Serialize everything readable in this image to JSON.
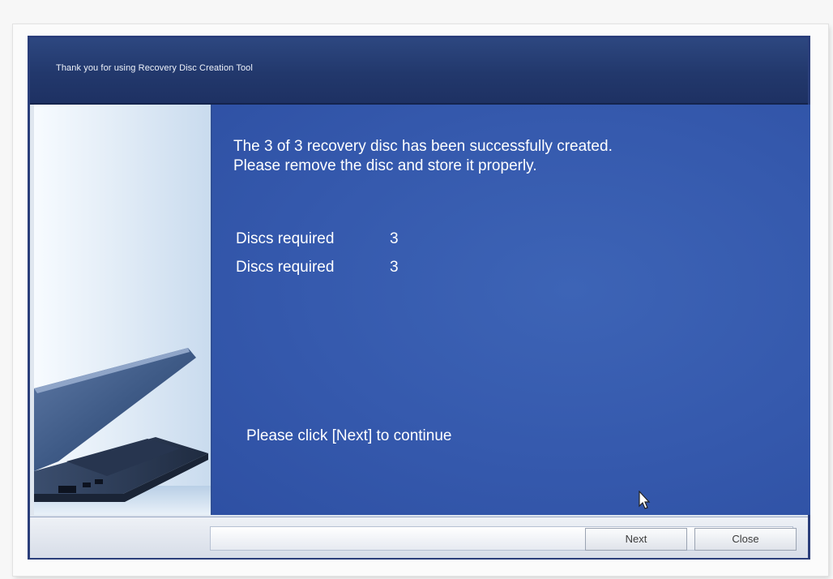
{
  "window": {
    "title": "Thank you for using Recovery Disc Creation Tool"
  },
  "content": {
    "message_line1": "The 3 of 3 recovery disc has been successfully created.",
    "message_line2": "Please remove the disc and store it properly.",
    "rows": [
      {
        "label": "Discs required",
        "value": "3"
      },
      {
        "label": "Discs required",
        "value": "3"
      }
    ],
    "hint": "Please click [Next] to continue"
  },
  "buttons": {
    "next_label": "Next",
    "close_label": "Close"
  },
  "icons": {
    "side_image": "laptop-illustration",
    "cursor": "mouse-cursor-icon"
  },
  "colors": {
    "title_bar": "#22386c",
    "content_panel": "#3559ad",
    "bottom_bar": "#dfe3ea",
    "text": "#ffffff"
  }
}
